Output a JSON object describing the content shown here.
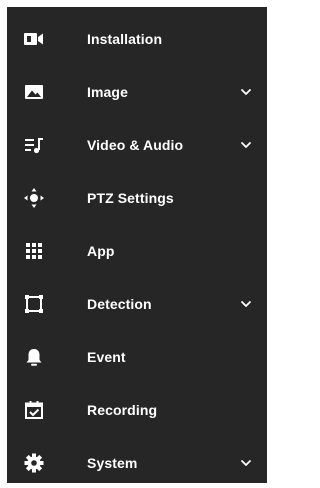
{
  "sidebar": {
    "background": "#262626",
    "text_color": "#ffffff",
    "items": [
      {
        "label": "Installation",
        "icon": "video-camera-icon",
        "expandable": false
      },
      {
        "label": "Image",
        "icon": "image-icon",
        "expandable": true
      },
      {
        "label": "Video & Audio",
        "icon": "audio-list-icon",
        "expandable": true
      },
      {
        "label": "PTZ Settings",
        "icon": "ptz-move-icon",
        "expandable": false
      },
      {
        "label": "App",
        "icon": "apps-grid-icon",
        "expandable": false
      },
      {
        "label": "Detection",
        "icon": "detection-frame-icon",
        "expandable": true
      },
      {
        "label": "Event",
        "icon": "bell-icon",
        "expandable": false
      },
      {
        "label": "Recording",
        "icon": "calendar-check-icon",
        "expandable": false
      },
      {
        "label": "System",
        "icon": "gear-icon",
        "expandable": true
      }
    ]
  }
}
